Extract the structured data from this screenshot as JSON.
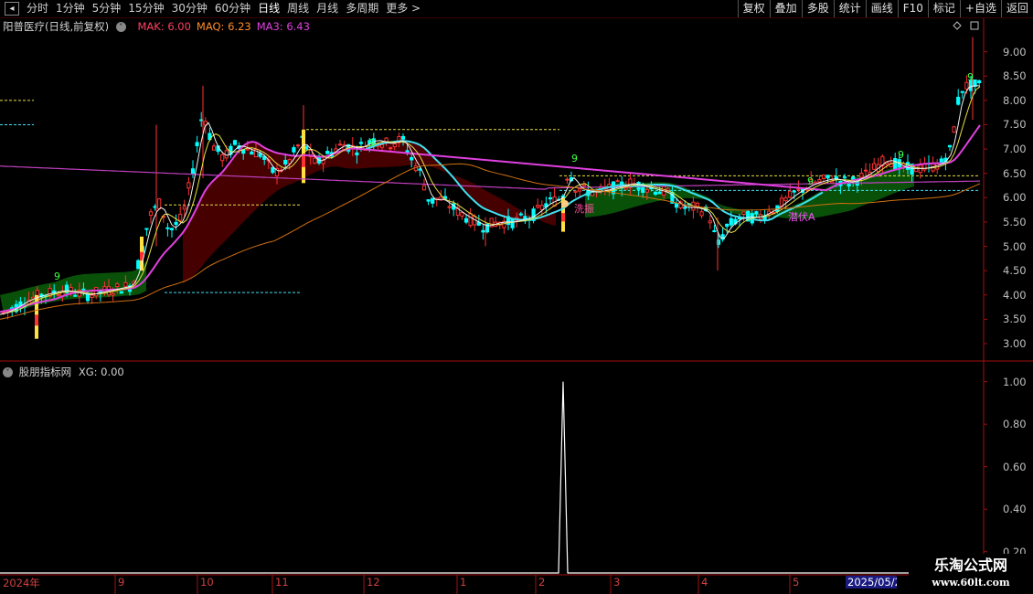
{
  "toolbar": {
    "prev_icon": "chevron-left-icon",
    "periods": [
      "分时",
      "1分钟",
      "5分钟",
      "15分钟",
      "30分钟",
      "60分钟",
      "日线",
      "周线",
      "月线",
      "多周期"
    ],
    "active_period": "日线",
    "more": "更多 >",
    "buttons": [
      "复权",
      "叠加",
      "多股",
      "统计",
      "画线",
      "F10",
      "标记",
      "+自选",
      "返回"
    ]
  },
  "main_panel": {
    "title": "阳普医疗(日线,前复权)",
    "ma_labels": [
      {
        "text": "MAK: 6.00",
        "color": "#ff4060"
      },
      {
        "text": "MAQ: 6.23",
        "color": "#ff8c2a"
      },
      {
        "text": "MA3: 6.43",
        "color": "#e040e0"
      }
    ],
    "y_ticks": [
      "9.00",
      "8.50",
      "8.00",
      "7.50",
      "7.00",
      "6.50",
      "6.00",
      "5.50",
      "5.00",
      "4.50",
      "4.00",
      "3.50",
      "3.00"
    ],
    "annotations": [
      {
        "text": "9",
        "color": "#40ff40"
      },
      {
        "text": "9",
        "color": "#40ff40"
      },
      {
        "text": "9",
        "color": "#40ff40"
      },
      {
        "text": "9",
        "color": "#40ff40"
      },
      {
        "text": "9",
        "color": "#40ff40"
      },
      {
        "text": "9",
        "color": "#40ff40"
      },
      {
        "text": "洗振",
        "color": "#ff50a0"
      },
      {
        "text": "潜伏A",
        "color": "#ff50ff"
      }
    ]
  },
  "sub_panel": {
    "title": "股朋指标网",
    "value_label": "XG: 0.00",
    "y_ticks": [
      "1.00",
      "0.80",
      "0.60",
      "0.40",
      "0.20"
    ]
  },
  "x_axis": {
    "year_label": "2024年",
    "months": [
      "9",
      "10",
      "11",
      "12",
      "1",
      "2",
      "3",
      "4",
      "5"
    ],
    "current_date": "2025/05/2"
  },
  "watermark": {
    "line1": "乐淘公式网",
    "line2": "www.60lt.com"
  },
  "chart_data": {
    "type": "candlestick",
    "title": "阳普医疗(日线,前复权)",
    "ylim": [
      2.7,
      9.5
    ],
    "x_range": [
      "2024-08",
      "2025-05"
    ],
    "price_path": [
      [
        0,
        3.6
      ],
      [
        12,
        3.7
      ],
      [
        30,
        3.9
      ],
      [
        45,
        4.0
      ],
      [
        70,
        4.1
      ],
      [
        95,
        4.0
      ],
      [
        120,
        4.1
      ],
      [
        145,
        4.2
      ],
      [
        155,
        4.9
      ],
      [
        163,
        5.6
      ],
      [
        175,
        5.9
      ],
      [
        185,
        5.3
      ],
      [
        200,
        5.6
      ],
      [
        212,
        6.7
      ],
      [
        222,
        7.8
      ],
      [
        232,
        7.1
      ],
      [
        245,
        6.8
      ],
      [
        258,
        7.1
      ],
      [
        270,
        7.0
      ],
      [
        285,
        6.9
      ],
      [
        300,
        6.5
      ],
      [
        315,
        6.7
      ],
      [
        330,
        7.2
      ],
      [
        345,
        6.7
      ],
      [
        360,
        6.9
      ],
      [
        375,
        7.1
      ],
      [
        390,
        7.0
      ],
      [
        410,
        7.2
      ],
      [
        425,
        7.1
      ],
      [
        440,
        7.2
      ],
      [
        450,
        6.8
      ],
      [
        460,
        6.5
      ],
      [
        470,
        5.9
      ],
      [
        480,
        6.0
      ],
      [
        495,
        5.8
      ],
      [
        510,
        5.6
      ],
      [
        530,
        5.4
      ],
      [
        545,
        5.5
      ],
      [
        560,
        5.5
      ],
      [
        580,
        5.6
      ],
      [
        600,
        5.9
      ],
      [
        615,
        6.0
      ],
      [
        622,
        6.6
      ],
      [
        630,
        6.2
      ],
      [
        650,
        6.1
      ],
      [
        670,
        6.2
      ],
      [
        690,
        6.3
      ],
      [
        710,
        6.2
      ],
      [
        730,
        6.1
      ],
      [
        745,
        5.8
      ],
      [
        760,
        5.8
      ],
      [
        775,
        5.7
      ],
      [
        785,
        5.0
      ],
      [
        795,
        5.4
      ],
      [
        810,
        5.6
      ],
      [
        830,
        5.6
      ],
      [
        850,
        5.8
      ],
      [
        870,
        6.1
      ],
      [
        890,
        6.3
      ],
      [
        910,
        6.4
      ],
      [
        930,
        6.3
      ],
      [
        950,
        6.5
      ],
      [
        970,
        6.8
      ],
      [
        990,
        6.6
      ],
      [
        1010,
        6.6
      ],
      [
        1030,
        6.7
      ],
      [
        1040,
        7.0
      ],
      [
        1050,
        8.2
      ],
      [
        1058,
        8.3
      ],
      [
        1066,
        8.3
      ],
      [
        1072,
        8.3
      ]
    ],
    "series": [
      {
        "name": "MAK",
        "last": 6.0
      },
      {
        "name": "MAQ",
        "last": 6.23
      },
      {
        "name": "MA3",
        "last": 6.43
      }
    ],
    "indicator": {
      "name": "XG",
      "value": 0.0,
      "spike_value": 1.0,
      "ylim": [
        0.1,
        1.05
      ]
    }
  },
  "colors": {
    "up": "#ff3232",
    "down": "#00ffff",
    "bg": "#000000",
    "axis": "#a01010",
    "cyan_line": "#40e0f0",
    "magenta_line": "#e040e0",
    "yellow_line": "#e8e040",
    "white_line": "#f0f0f0",
    "fill_dark_red": "#4a0000",
    "fill_green": "#0a5a0a"
  }
}
